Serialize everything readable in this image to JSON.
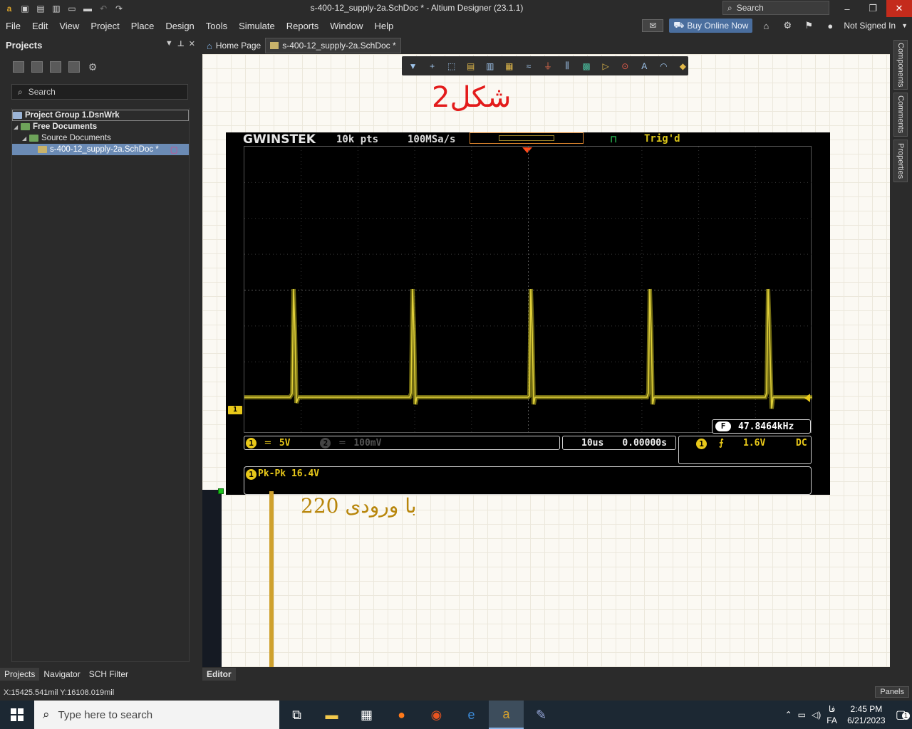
{
  "window": {
    "title": "s-400-12_supply-2a.SchDoc * - Altium Designer (23.1.1)",
    "search_label": "Search",
    "min": "–",
    "max": "❐",
    "close": "✕"
  },
  "menu": {
    "items": [
      "File",
      "Edit",
      "View",
      "Project",
      "Place",
      "Design",
      "Tools",
      "Simulate",
      "Reports",
      "Window",
      "Help"
    ],
    "buy_label": "Buy Online Now",
    "user_label": "Not Signed In"
  },
  "projects_panel": {
    "title": "Projects",
    "search_label": "Search",
    "tree": {
      "group": "Project Group 1.DsnWrk",
      "free_docs": "Free Documents",
      "source_docs": "Source Documents",
      "doc": "s-400-12_supply-2a.SchDoc *"
    },
    "bottom_tabs": [
      "Projects",
      "Navigator",
      "SCH Filter"
    ]
  },
  "editor": {
    "tabs": [
      "Home Page",
      "s-400-12_supply-2a.SchDoc *"
    ],
    "bottom_tab": "Editor",
    "figure_title": "شکل2",
    "caption": "با ورودی 220"
  },
  "scope": {
    "brand": "GWINSTEK",
    "points": "10k pts",
    "rate": "100MSa/s",
    "trig_status": "Trig'd",
    "freq": "47.8464kHz",
    "freq_badge": "F",
    "ch1_marker": "1",
    "ch1_scale": "5V",
    "ch2_scale": "100mV",
    "timebase": "10us",
    "delay": "0.00000s",
    "trig_level": "1.6V",
    "coupling": "DC",
    "measurement": "Pk-Pk 16.4V"
  },
  "right_tabs": [
    "Components",
    "Comments",
    "Properties"
  ],
  "status": {
    "coords": "X:15425.541mil Y:16108.019mil",
    "panels": "Panels"
  },
  "taskbar": {
    "search_placeholder": "Type here to search",
    "lang_short": "فا",
    "lang": "FA",
    "time": "2:45 PM",
    "date": "6/21/2023",
    "notif_count": "1"
  },
  "colors": {
    "accent": "#4a6e9e",
    "trace": "#d9c41a",
    "figure_title": "#e31b1b",
    "caption": "#b8860b"
  }
}
